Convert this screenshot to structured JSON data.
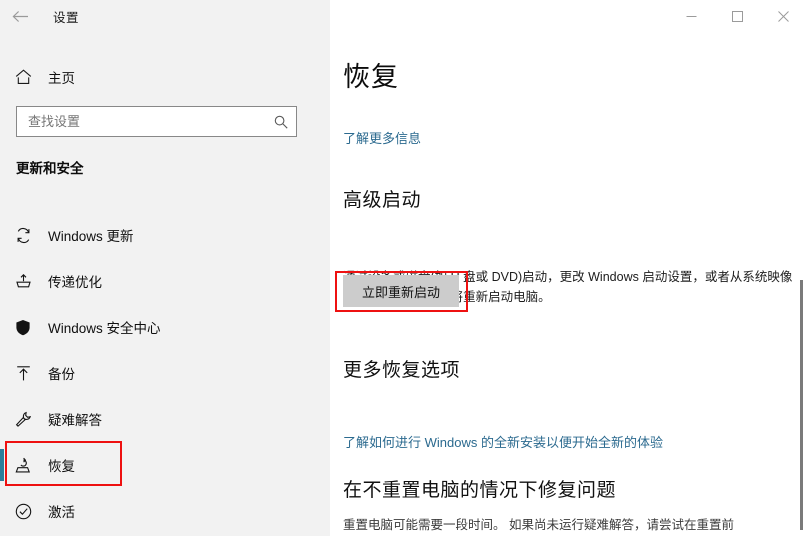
{
  "window": {
    "title": "设置",
    "back_icon": "back-arrow-icon",
    "controls": [
      {
        "name": "minimize-button",
        "icon": "minimize-icon"
      },
      {
        "name": "maximize-button",
        "icon": "maximize-icon"
      },
      {
        "name": "close-button",
        "icon": "close-icon"
      }
    ]
  },
  "sidebar": {
    "home_label": "主页",
    "home_icon": "home-icon",
    "search": {
      "placeholder": "查找设置",
      "value": "",
      "icon": "search-icon"
    },
    "category": "更新和安全",
    "items": [
      {
        "label": "Windows 更新",
        "icon": "sync-icon",
        "selected": false
      },
      {
        "label": "传递优化",
        "icon": "delivery-icon",
        "selected": false
      },
      {
        "label": "Windows 安全中心",
        "icon": "shield-icon",
        "selected": false
      },
      {
        "label": "备份",
        "icon": "upload-icon",
        "selected": false
      },
      {
        "label": "疑难解答",
        "icon": "wrench-icon",
        "selected": false
      },
      {
        "label": "恢复",
        "icon": "recovery-icon",
        "selected": true
      },
      {
        "label": "激活",
        "icon": "check-circle-icon",
        "selected": false
      }
    ],
    "accent_color": "#2d7d9a"
  },
  "main": {
    "page_title": "恢复",
    "learn_more_link": "了解更多信息",
    "advanced_startup": {
      "heading": "高级启动",
      "description": "通过设备或磁盘(如 U 盘或 DVD)启动，更改 Windows 启动设置，或者从系统映像还原 Windows。 这将重新启动电脑。",
      "button_label": "立即重新启动"
    },
    "more_recovery": {
      "heading": "更多恢复选项",
      "link": "了解如何进行 Windows 的全新安装以便开始全新的体验"
    },
    "fix_problems": {
      "heading": "在不重置电脑的情况下修复问题",
      "description": "重置电脑可能需要一段时间。 如果尚未运行疑难解答，请尝试在重置前"
    },
    "link_color": "#2b6a8f"
  },
  "annotations": {
    "highlight_color": "#ee1111",
    "targets": [
      "恢复",
      "立即重新启动"
    ]
  }
}
